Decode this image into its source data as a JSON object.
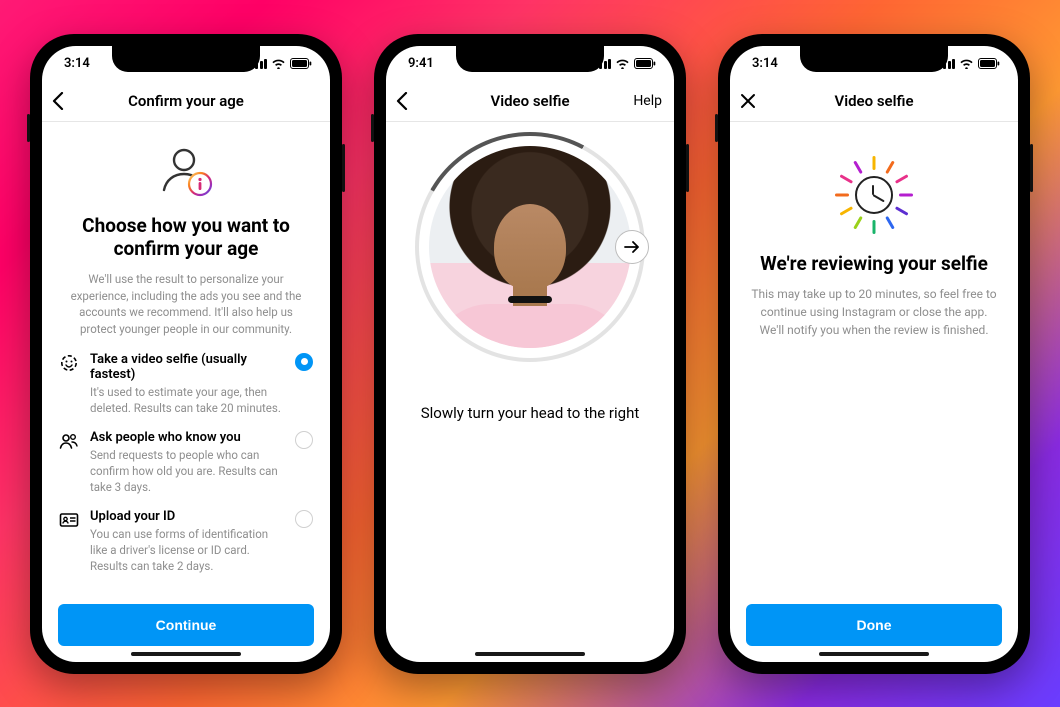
{
  "phone1": {
    "time": "3:14",
    "nav_title": "Confirm your age",
    "heading": "Choose how you want to confirm your age",
    "description": "We'll use the result to personalize your experience, including the ads you see and the accounts we recommend. It'll also help us protect younger people in our community.",
    "options": [
      {
        "title": "Take a video selfie (usually fastest)",
        "desc": "It's used to estimate your age, then deleted. Results can take 20 minutes.",
        "selected": true
      },
      {
        "title": "Ask people who know you",
        "desc": "Send requests to people who can confirm how old you are. Results can take 3 days.",
        "selected": false
      },
      {
        "title": "Upload your ID",
        "desc": "You can use forms of identification like a driver's license or ID card. Results can take 2 days.",
        "selected": false
      }
    ],
    "cta": "Continue"
  },
  "phone2": {
    "time": "9:41",
    "nav_title": "Video selfie",
    "help": "Help",
    "instruction": "Slowly turn your head to the right"
  },
  "phone3": {
    "time": "3:14",
    "nav_title": "Video selfie",
    "heading": "We're reviewing your selfie",
    "description": "This may take up to 20 minutes, so feel free to continue using Instagram or close the app. We'll notify you when the review is finished.",
    "cta": "Done"
  },
  "ray_colors": [
    "#f7b500",
    "#f26b1d",
    "#e8318a",
    "#b41ecf",
    "#5c2ed1",
    "#2d67f0",
    "#19b46a",
    "#9ad11a",
    "#f7b500",
    "#f26b1d",
    "#e8318a",
    "#b41ecf"
  ]
}
